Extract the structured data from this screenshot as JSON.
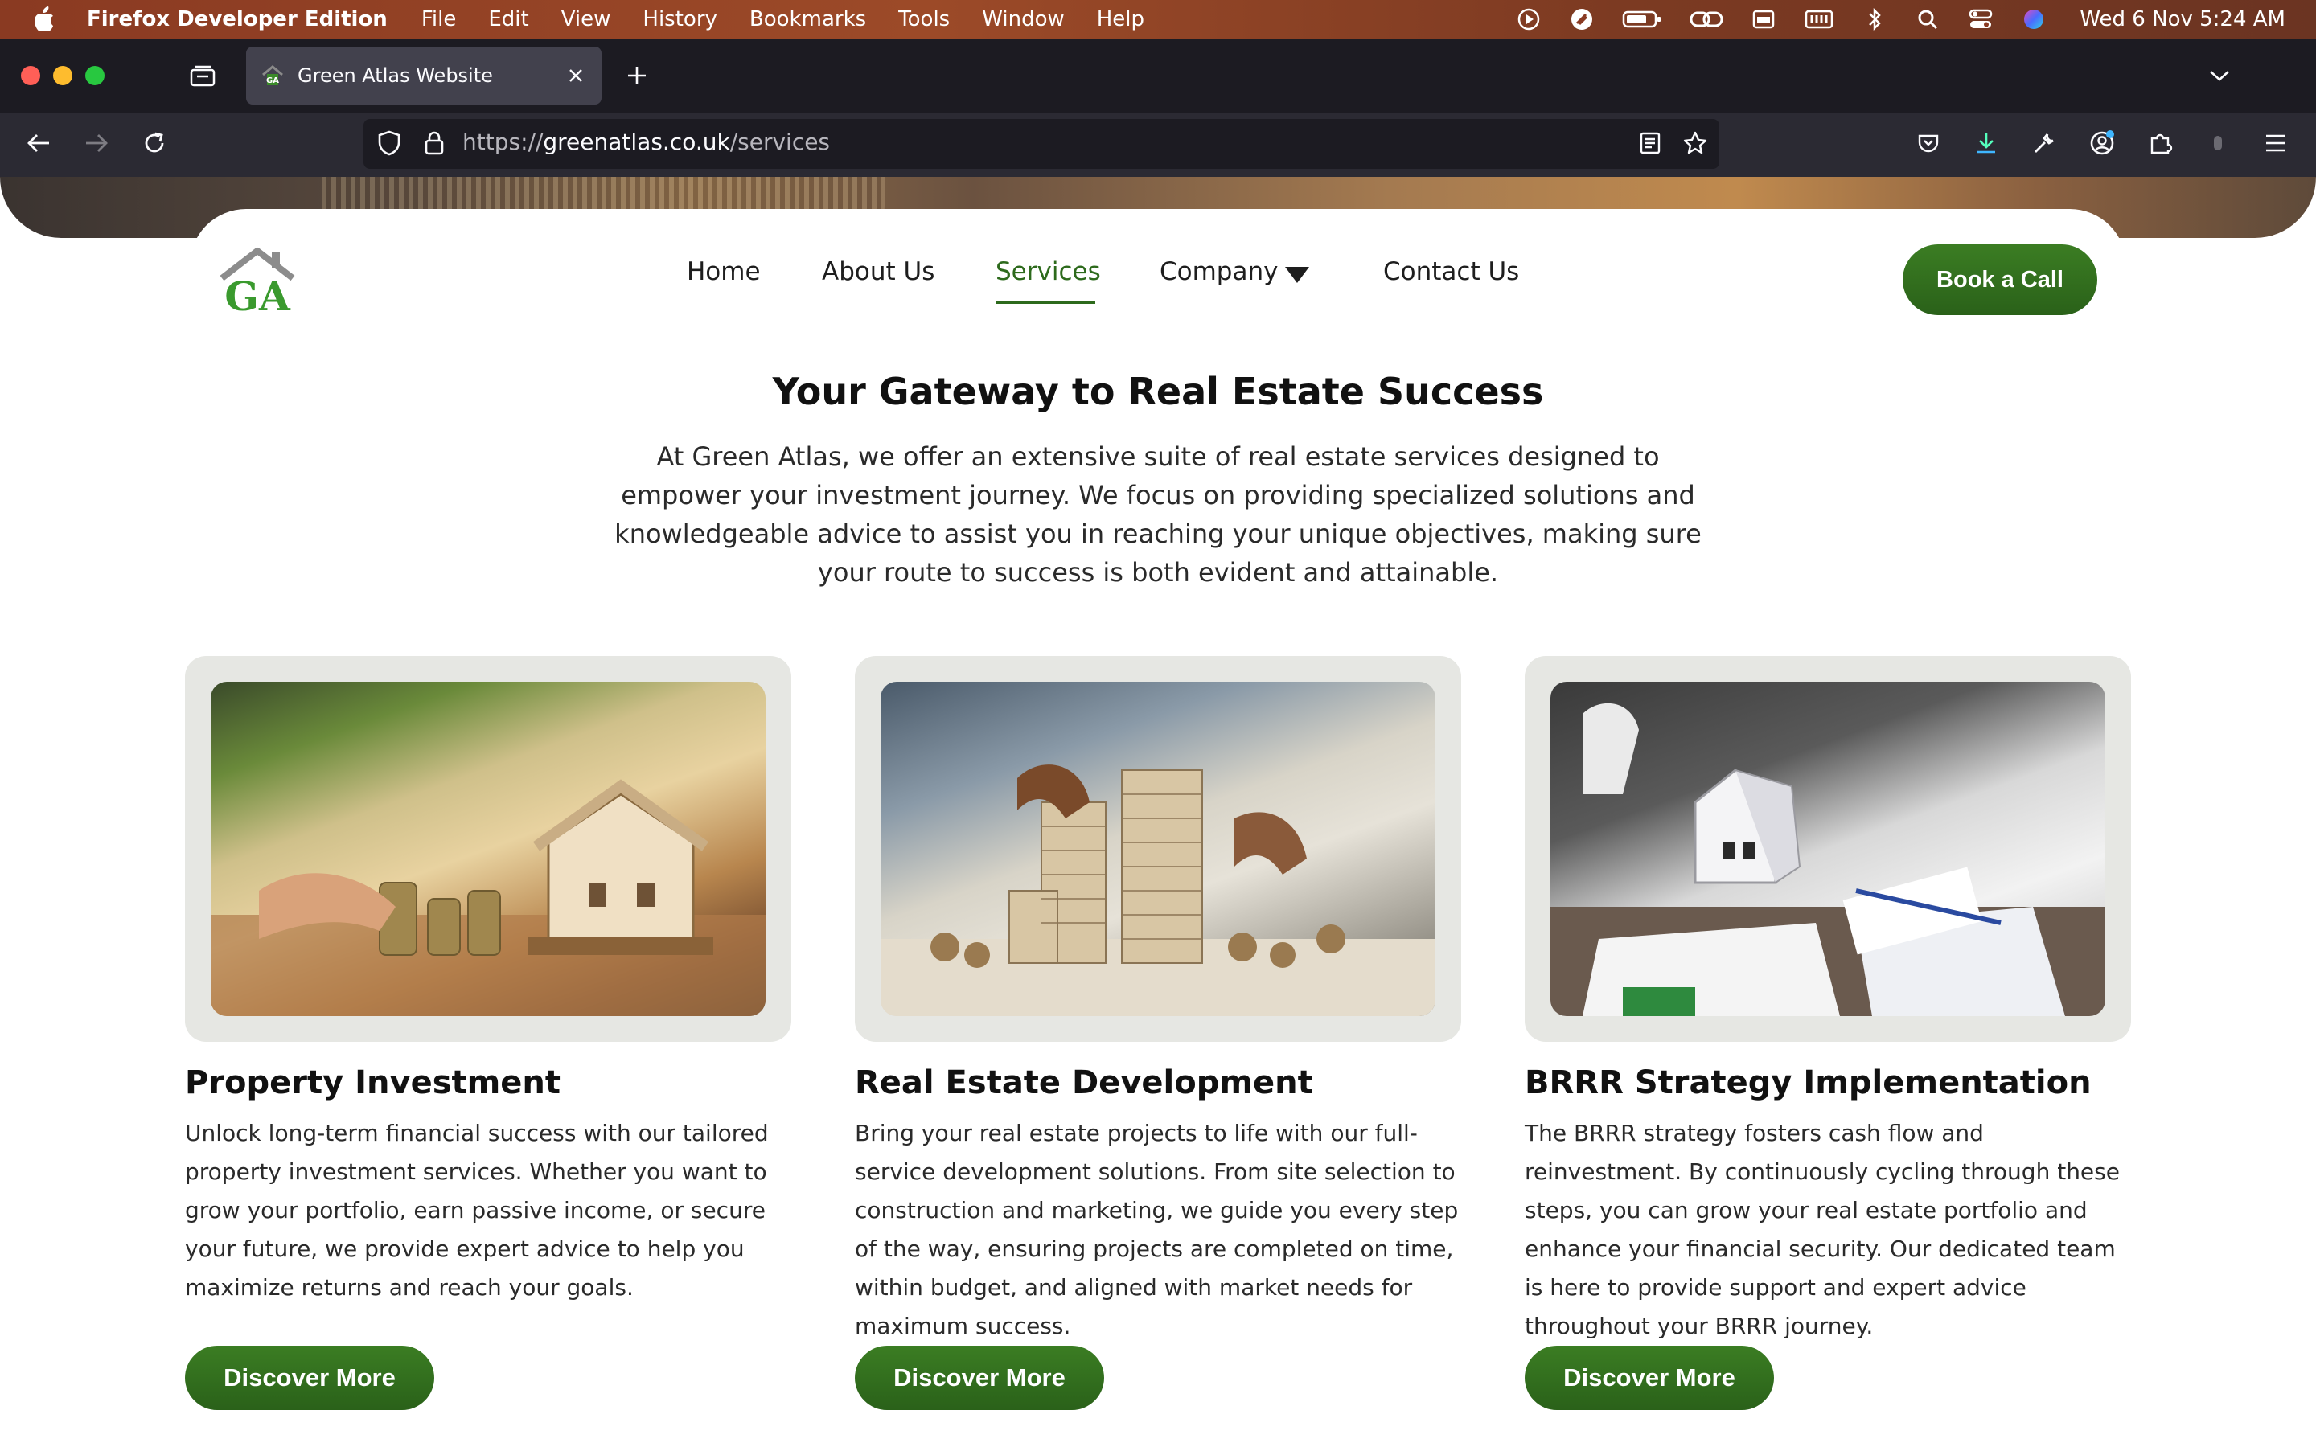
{
  "menubar": {
    "app_name": "Firefox Developer Edition",
    "items": [
      "File",
      "Edit",
      "View",
      "History",
      "Bookmarks",
      "Tools",
      "Window",
      "Help"
    ],
    "clock": "Wed 6 Nov  5:24 AM",
    "status_icons": [
      "play-icon",
      "reeder-icon",
      "battery-icon",
      "link-icon",
      "calendar-icon",
      "memory-icon",
      "bluetooth-icon",
      "spotlight-icon",
      "control-center-icon",
      "siri-icon"
    ]
  },
  "browser": {
    "tab_title": "Green Atlas Website",
    "url_prefix": "https://",
    "url_domain": "greenatlas.co.uk",
    "url_path": "/services"
  },
  "site": {
    "nav": {
      "home": "Home",
      "about": "About Us",
      "services": "Services",
      "company": "Company",
      "contact": "Contact Us",
      "cta": "Book a Call"
    },
    "headline": "Your Gateway to Real Estate Success",
    "intro": "At Green Atlas, we offer an extensive suite of real estate services designed to empower your investment journey. We focus on providing specialized solutions and knowledgeable advice to assist you in reaching your unique objectives, making sure your route to success is both evident and attainable.",
    "services": [
      {
        "title": "Property Investment",
        "description": "Unlock long-term financial success with our tailored property investment services. Whether you want to grow your portfolio, earn passive income, or secure your future, we provide expert advice to help you maximize returns and reach your goals.",
        "button": "Discover More"
      },
      {
        "title": "Real Estate Development",
        "description": "Bring your real estate projects to life with our full-service development solutions. From site selection to construction and marketing, we guide you every step of the way, ensuring projects are completed on time, within budget, and aligned with market needs for maximum success.",
        "button": "Discover More"
      },
      {
        "title": "BRRR Strategy Implementation",
        "description": "The BRRR strategy fosters cash flow and reinvestment. By continuously cycling through these steps, you can grow your real estate portfolio and enhance your financial security. Our dedicated team is here to provide support and expert advice throughout your BRRR journey.",
        "button": "Discover More"
      }
    ]
  },
  "colors": {
    "brand_green": "#2d6a1c",
    "button_green": "#3b7d23",
    "card_frame": "#e6e7e3"
  }
}
